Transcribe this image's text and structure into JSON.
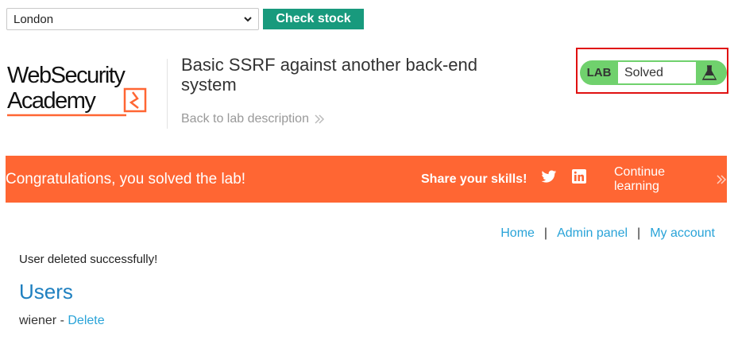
{
  "stock_check": {
    "selected_store": "London",
    "check_button_label": "Check stock"
  },
  "header": {
    "logo_line1": "WebSecurity",
    "logo_line2": "Academy",
    "lab_title": "Basic SSRF against another back-end system",
    "back_link_label": "Back to lab description",
    "lab_badge": "LAB",
    "lab_status": "Solved",
    "colors": {
      "status_green": "#70d16d",
      "highlight_red": "#e01010"
    }
  },
  "banner": {
    "message": "Congratulations, you solved the lab!",
    "share_label": "Share your skills!",
    "icons": [
      "twitter-icon",
      "linkedin-icon"
    ],
    "continue_label": "Continue learning",
    "color": "#ff6633"
  },
  "nav": {
    "home": "Home",
    "separator": "|",
    "admin_panel": "Admin panel",
    "my_account": "My account"
  },
  "main": {
    "message": "User deleted successfully!",
    "users_heading": "Users",
    "users": [
      {
        "name": "wiener",
        "separator": " - ",
        "action": "Delete"
      }
    ]
  }
}
